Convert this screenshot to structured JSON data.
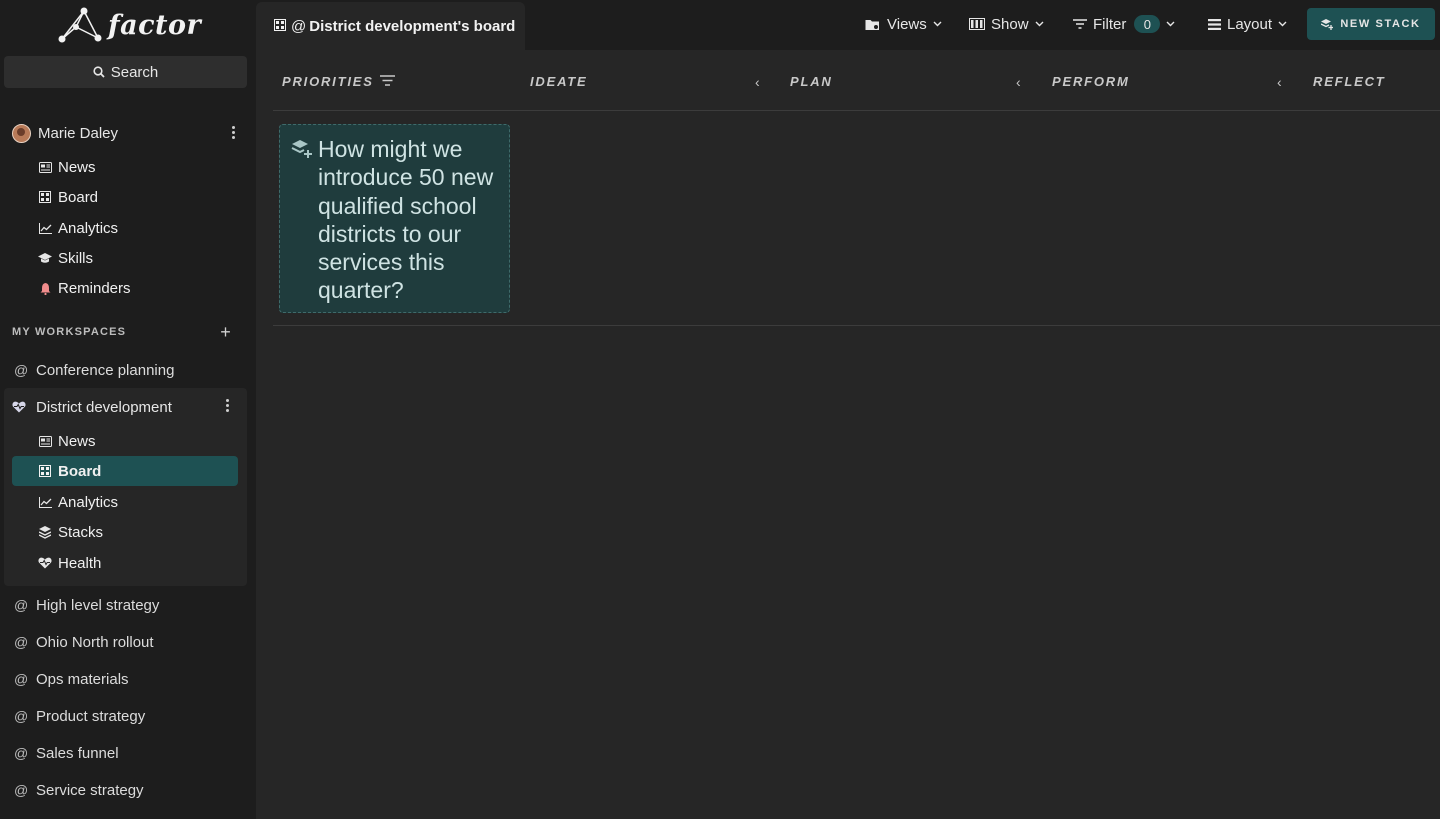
{
  "app": {
    "logo_text": "factor"
  },
  "search": {
    "label": "Search"
  },
  "user": {
    "name": "Marie Daley"
  },
  "user_nav": [
    {
      "label": "News",
      "icon": "news-icon"
    },
    {
      "label": "Board",
      "icon": "board-icon"
    },
    {
      "label": "Analytics",
      "icon": "analytics-icon"
    },
    {
      "label": "Skills",
      "icon": "skills-icon"
    },
    {
      "label": "Reminders",
      "icon": "bell-icon"
    }
  ],
  "workspaces": {
    "header": "MY WORKSPACES",
    "add": "+",
    "items": [
      {
        "label": "Conference planning"
      },
      {
        "label": "District development"
      },
      {
        "label": "High level strategy"
      },
      {
        "label": "Ohio North rollout"
      },
      {
        "label": "Ops materials"
      },
      {
        "label": "Product strategy"
      },
      {
        "label": "Sales funnel"
      },
      {
        "label": "Service strategy"
      }
    ],
    "active_nav": [
      {
        "label": "News",
        "icon": "news-icon"
      },
      {
        "label": "Board",
        "icon": "board-icon",
        "active": true
      },
      {
        "label": "Analytics",
        "icon": "analytics-icon"
      },
      {
        "label": "Stacks",
        "icon": "stacks-icon"
      },
      {
        "label": "Health",
        "icon": "health-icon"
      }
    ]
  },
  "topbar": {
    "tab_title": "District development's board",
    "tab_at": "@",
    "views": "Views",
    "show": "Show",
    "filter": "Filter",
    "filter_count": "0",
    "layout": "Layout",
    "new_stack": "NEW STACK"
  },
  "board": {
    "columns": [
      "PRIORITIES",
      "IDEATE",
      "PLAN",
      "PERFORM",
      "REFLECT"
    ],
    "arrow": "‹",
    "cards": [
      {
        "text": "How might we introduce 50 new qualified school districts to our services this quarter?"
      }
    ]
  },
  "colors": {
    "accent": "#1e5153",
    "sidebar_bg": "#1d1d1d",
    "main_bg": "#262626",
    "card_bg": "#1f3c3d"
  }
}
